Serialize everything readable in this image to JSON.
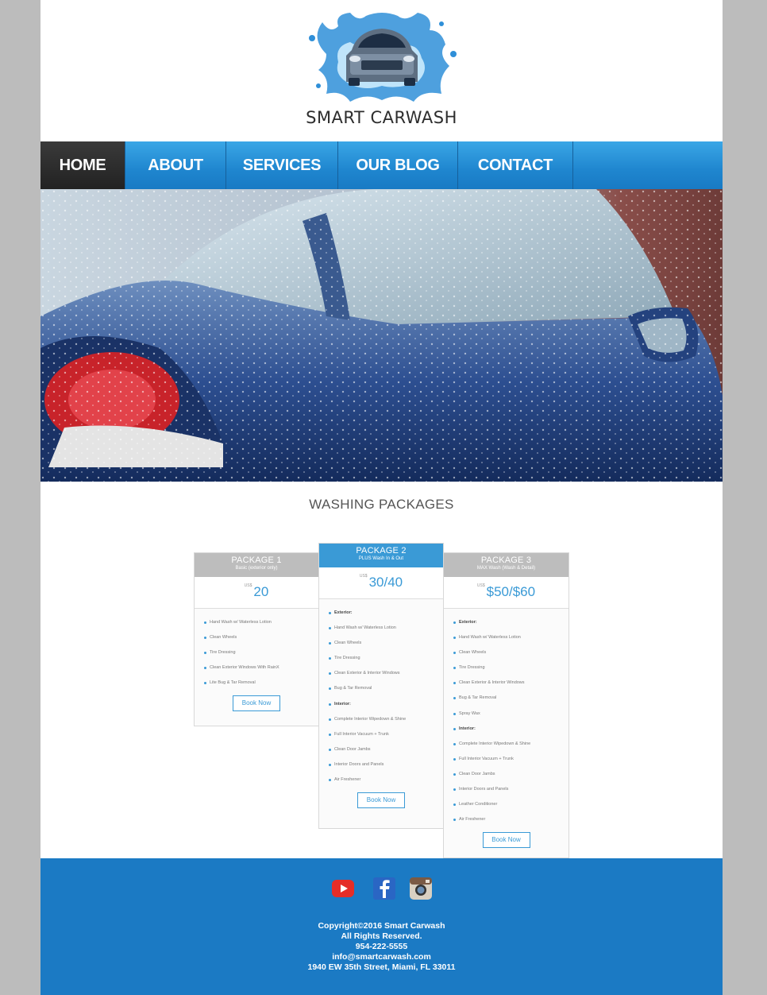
{
  "brand": {
    "name": "SMART CARWASH"
  },
  "nav": {
    "items": [
      {
        "label": "HOME",
        "active": true
      },
      {
        "label": "ABOUT",
        "active": false
      },
      {
        "label": "SERVICES",
        "active": false
      },
      {
        "label": "OUR BLOG",
        "active": false
      },
      {
        "label": "CONTACT",
        "active": false
      }
    ]
  },
  "hero": {
    "image": "blue-car-being-washed-photo"
  },
  "packages_section": {
    "title": "WASHING PACKAGES",
    "packages": [
      {
        "name": "PACKAGE 1",
        "subtitle": "Basic (exterior only)",
        "currency": "US$",
        "price": "20",
        "featured": false,
        "items": [
          {
            "text": "Hand Wash w/ Waterless Lotion",
            "category": false
          },
          {
            "text": "Clean Wheels",
            "category": false
          },
          {
            "text": "Tire Dressing",
            "category": false
          },
          {
            "text": "Clean Exterior Windows With RainX",
            "category": false
          },
          {
            "text": "Lite Bug & Tar Removal",
            "category": false
          }
        ],
        "button": "Book Now"
      },
      {
        "name": "PACKAGE 2",
        "subtitle": "PLUS Wash In & Out",
        "currency": "US$",
        "price": "30/40",
        "featured": true,
        "items": [
          {
            "text": "Exterior:",
            "category": true
          },
          {
            "text": "Hand Wash w/ Waterless Lotion",
            "category": false
          },
          {
            "text": "Clean Wheels",
            "category": false
          },
          {
            "text": "Tire Dressing",
            "category": false
          },
          {
            "text": "Clean Exterior & Interior Windows",
            "category": false
          },
          {
            "text": "Bug & Tar Removal",
            "category": false
          },
          {
            "text": "Interior:",
            "category": true
          },
          {
            "text": "Complete Interior Wipedown & Shine",
            "category": false
          },
          {
            "text": "Full Interior Vacuum + Trunk",
            "category": false
          },
          {
            "text": "Clean Door Jambs",
            "category": false
          },
          {
            "text": "Interior Doors and Panels",
            "category": false
          },
          {
            "text": "Air Freshener",
            "category": false
          }
        ],
        "button": "Book Now"
      },
      {
        "name": "PACKAGE 3",
        "subtitle": "MAX Wash (Wash & Detail)",
        "currency": "US$",
        "price": "$50/$60",
        "featured": false,
        "items": [
          {
            "text": "Exterior:",
            "category": true
          },
          {
            "text": "Hand Wash w/ Waterless Lotion",
            "category": false
          },
          {
            "text": "Clean Wheels",
            "category": false
          },
          {
            "text": "Tire Dressing",
            "category": false
          },
          {
            "text": "Clean Exterior & Interior Windows",
            "category": false
          },
          {
            "text": "Bug & Tar Removal",
            "category": false
          },
          {
            "text": "Spray Wax",
            "category": false
          },
          {
            "text": "Interior:",
            "category": true
          },
          {
            "text": "Complete Interior Wipedown & Shine",
            "category": false
          },
          {
            "text": "Full Interior Vacuum + Trunk",
            "category": false
          },
          {
            "text": "Clean Door Jambs",
            "category": false
          },
          {
            "text": "Interior Doors and Panels",
            "category": false
          },
          {
            "text": "Leather Conditioner",
            "category": false
          },
          {
            "text": "Air Freshener",
            "category": false
          }
        ],
        "button": "Book Now"
      }
    ]
  },
  "footer": {
    "social": [
      "youtube-icon",
      "facebook-icon",
      "instagram-icon"
    ],
    "lines": [
      "Copyright©2016 Smart Carwash",
      "All Rights Reserved.",
      "954-222-5555",
      "info@smartcarwash.com",
      "1940 EW 35th Street, Miami, FL 33011"
    ]
  },
  "colors": {
    "accent": "#3a9ad6",
    "nav_blue": "#1f86cf",
    "footer_blue": "#1b7ac4",
    "active_nav": "#2a2a2a",
    "package_header_grey": "#bdbdbd"
  }
}
